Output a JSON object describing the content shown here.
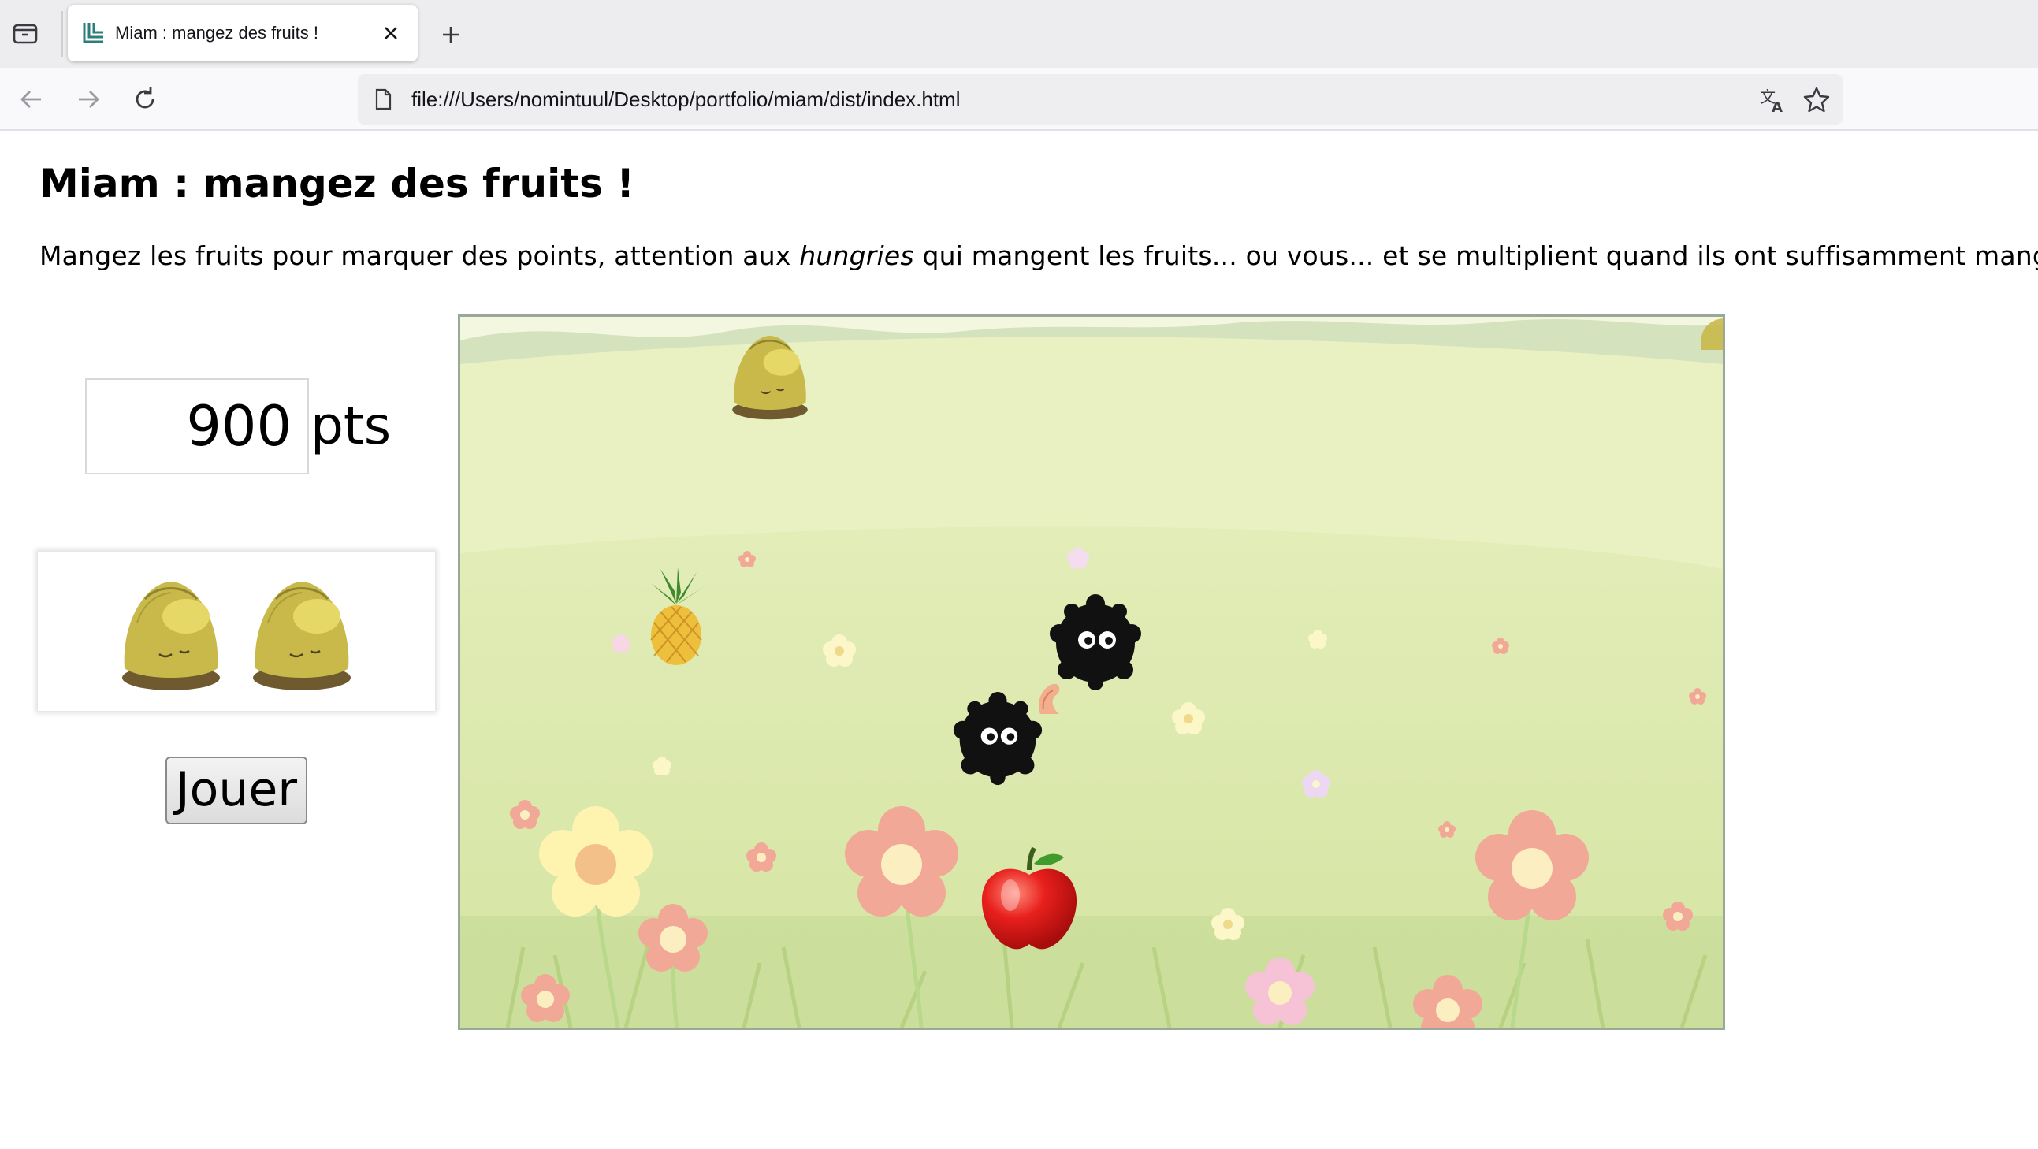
{
  "browser": {
    "tab": {
      "title": "Miam : mangez des fruits !"
    },
    "url": "file:///Users/nomintuul/Desktop/portfolio/miam/dist/index.html"
  },
  "page": {
    "title": "Miam : mangez des fruits !",
    "intro_before": "Mangez les fruits pour marquer des points, attention aux ",
    "intro_emphasis": "hungries",
    "intro_after": " qui mangent les fruits... ou vous... et se multiplient quand ils ont suffisamment mangé."
  },
  "game": {
    "score": "900",
    "score_unit": "pts",
    "lives": 2,
    "play_label": "Jouer",
    "sprites": [
      {
        "kind": "player",
        "icon": "kiwi-creature-icon"
      },
      {
        "kind": "fruit",
        "icon": "pineapple-icon"
      },
      {
        "kind": "fruit",
        "icon": "apple-icon"
      },
      {
        "kind": "hungry",
        "icon": "hungry-soot-icon"
      },
      {
        "kind": "hungry",
        "icon": "hungry-soot-icon"
      },
      {
        "kind": "fruit",
        "icon": "shrimp-icon"
      }
    ]
  },
  "colors": {
    "meadow_light": "#eef3c6",
    "meadow": "#d9e8a8",
    "flower_pink": "#f2a897",
    "flower_cream": "#fff3b0",
    "hungry": "#111111",
    "apple": "#e31b1b",
    "kiwi": "#c9b94a"
  }
}
